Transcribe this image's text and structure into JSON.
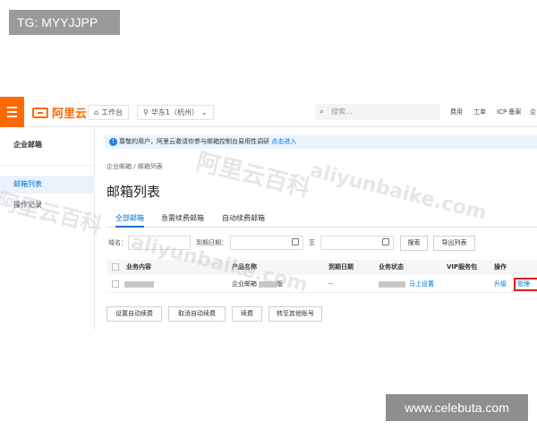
{
  "watermarks": {
    "top_left_label": "TG: MYYJJPP",
    "bottom_right_label": "www.celebuta.com",
    "overlay_cn": "阿里云百科",
    "overlay_latin": "aliyunbaike.com"
  },
  "topbar": {
    "logo_text": "阿里云",
    "workbench": "工作台",
    "region": "华东1（杭州）",
    "search_placeholder": "搜索...",
    "links": [
      "费用",
      "工单",
      "ICP 备案",
      "企"
    ]
  },
  "sidebar": {
    "title": "企业邮箱",
    "items": [
      {
        "label": "邮箱列表",
        "active": true
      },
      {
        "label": "操作记录",
        "active": false
      }
    ]
  },
  "notice": {
    "text": "尊敬的用户，阿里云邀请你参与邮箱控制台易用性调研",
    "link": "点击进入"
  },
  "breadcrumb": {
    "root": "企业邮箱",
    "separator": "/",
    "current": "邮箱列表"
  },
  "page_title": "邮箱列表",
  "tabs": [
    {
      "label": "全部邮箱",
      "active": true
    },
    {
      "label": "急需续费邮箱",
      "active": false
    },
    {
      "label": "自动续费邮箱",
      "active": false
    }
  ],
  "filter": {
    "domain_label": "域名：",
    "expiry_label": "到期日期：",
    "to_label": "至",
    "search_button": "搜索",
    "export_button": "导出列表"
  },
  "table": {
    "columns": [
      "业务内容",
      "产品名称",
      "到期日期",
      "业务状态",
      "VIP服务包",
      "操作"
    ],
    "rows": [
      {
        "product_prefix": "企业邮箱",
        "product_suffix": "版",
        "expiry": "--",
        "status_link": "马上设置",
        "vip": "",
        "action_upgrade": "升级",
        "action_manage": "管理"
      }
    ]
  },
  "actions": [
    "设置自动续费",
    "取消自动续费",
    "续费",
    "转至其他账号"
  ],
  "colors": {
    "brand_orange": "#ff6a00",
    "link_blue": "#0070cc",
    "highlight_red": "#d81e06"
  }
}
